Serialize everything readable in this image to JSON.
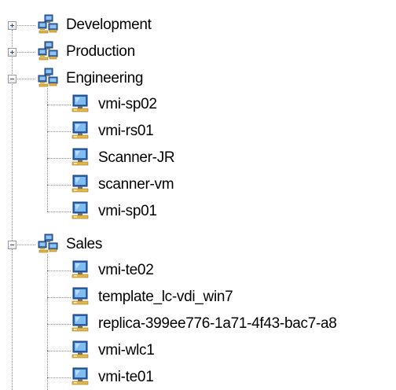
{
  "tree": {
    "groups": [
      {
        "label": "Development",
        "expanded": false,
        "icon": "server-group-icon",
        "children": []
      },
      {
        "label": "Production",
        "expanded": false,
        "icon": "server-group-icon",
        "children": []
      },
      {
        "label": "Engineering",
        "expanded": true,
        "icon": "server-group-icon",
        "children": [
          {
            "label": "vmi-sp02",
            "icon": "virtual-machine-icon"
          },
          {
            "label": "vmi-rs01",
            "icon": "virtual-machine-icon"
          },
          {
            "label": "Scanner-JR",
            "icon": "virtual-machine-icon"
          },
          {
            "label": "scanner-vm",
            "icon": "virtual-machine-icon"
          },
          {
            "label": "vmi-sp01",
            "icon": "virtual-machine-icon"
          }
        ]
      },
      {
        "label": "Sales",
        "expanded": true,
        "icon": "server-group-icon",
        "children": [
          {
            "label": "vmi-te02",
            "icon": "virtual-machine-icon"
          },
          {
            "label": "template_lc-vdi_win7",
            "icon": "virtual-machine-icon"
          },
          {
            "label": "replica-399ee776-1a71-4f43-bac7-a8",
            "icon": "virtual-machine-icon"
          },
          {
            "label": "vmi-wlc1",
            "icon": "virtual-machine-icon"
          },
          {
            "label": "vmi-te01",
            "icon": "virtual-machine-icon"
          }
        ]
      }
    ]
  },
  "colors": {
    "connector": "#8a8a8a",
    "expander_sign": "#2b4f8a",
    "text": "#000000"
  }
}
